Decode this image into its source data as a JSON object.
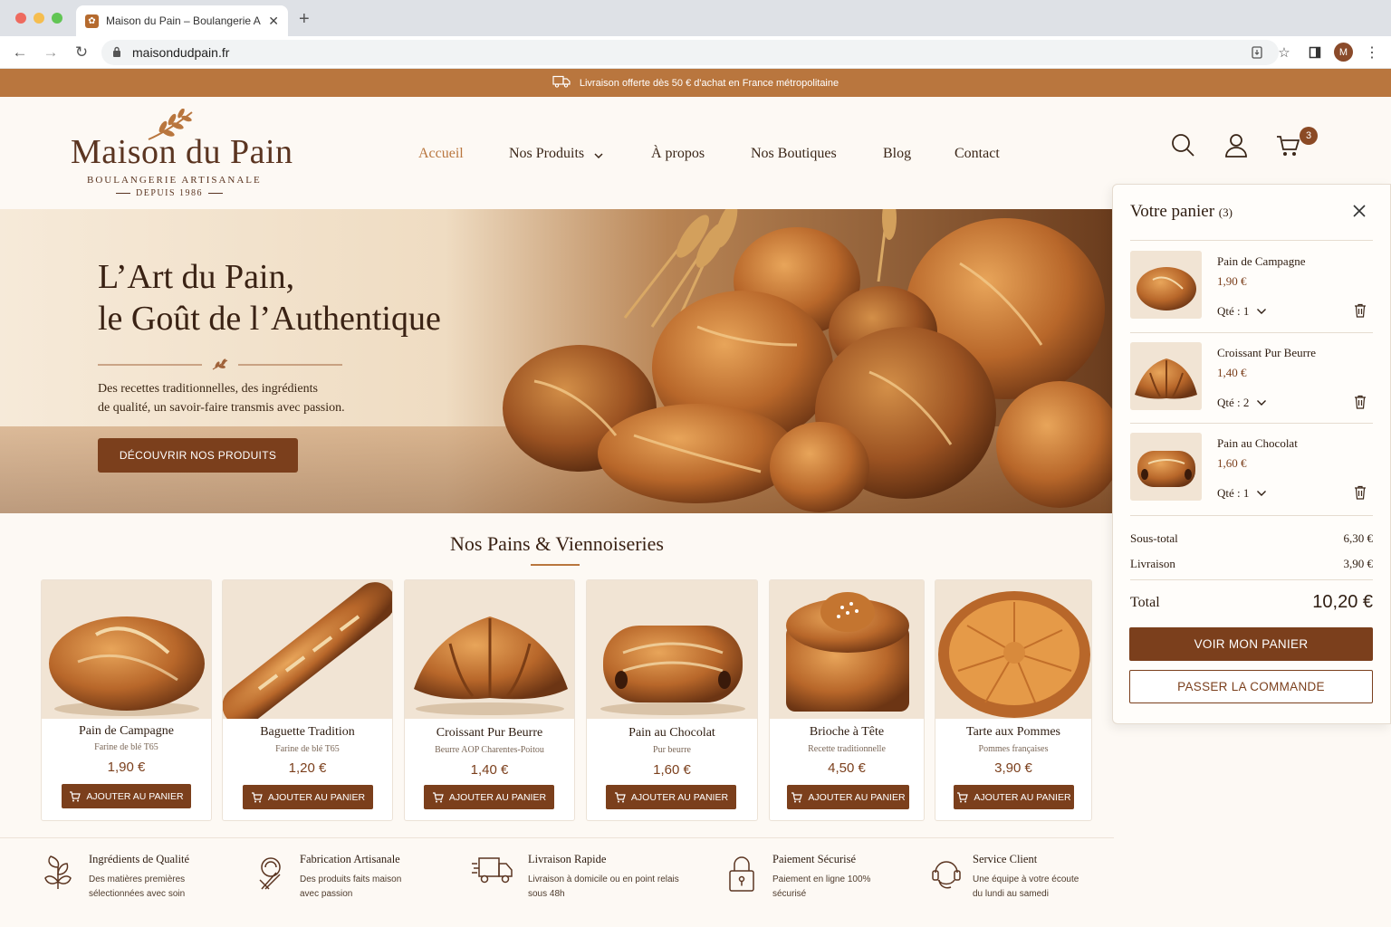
{
  "browser": {
    "tab_title": "Maison du Pain – Boulangerie Artis",
    "url": "maisondudpain.fr",
    "profile_initial": "M"
  },
  "promo": {
    "text": "Livraison offerte dès 50 € d'achat en France métropolitaine"
  },
  "brand": {
    "name": "Maison du Pain",
    "tagline": "BOULANGERIE ARTISANALE",
    "since": "DEPUIS 1986"
  },
  "nav": {
    "items": [
      {
        "label": "Accueil",
        "active": true
      },
      {
        "label": "Nos Produits",
        "has_dropdown": true
      },
      {
        "label": "À propos"
      },
      {
        "label": "Nos Boutiques"
      },
      {
        "label": "Blog"
      },
      {
        "label": "Contact"
      }
    ],
    "cart_count": "3"
  },
  "hero": {
    "title_line1": "L’Art du Pain,",
    "title_line2": "le Goût de l’Authentique",
    "text_line1": "Des recettes traditionnelles, des ingrédients",
    "text_line2": "de qualité, un savoir-faire transmis avec passion.",
    "cta": "DÉCOUVRIR NOS PRODUITS"
  },
  "products": {
    "title": "Nos Pains & Viennoiseries",
    "add_label": "AJOUTER AU PANIER",
    "items": [
      {
        "name": "Pain de Campagne",
        "sub": "Farine de blé T65",
        "price": "1,90 €"
      },
      {
        "name": "Baguette Tradition",
        "sub": "Farine de blé T65",
        "price": "1,20 €"
      },
      {
        "name": "Croissant Pur Beurre",
        "sub": "Beurre AOP Charentes-Poitou",
        "price": "1,40 €"
      },
      {
        "name": "Pain au Chocolat",
        "sub": "Pur beurre",
        "price": "1,60 €"
      },
      {
        "name": "Brioche à Tête",
        "sub": "Recette traditionnelle",
        "price": "4,50 €"
      },
      {
        "name": "Tarte aux Pommes",
        "sub": "Pommes françaises",
        "price": "3,90 €"
      }
    ]
  },
  "features": [
    {
      "title": "Ingrédients de Qualité",
      "line1": "Des matières premières",
      "line2": "sélectionnées avec soin",
      "icon": "leaves-icon"
    },
    {
      "title": "Fabrication Artisanale",
      "line1": "Des produits faits maison",
      "line2": "avec passion",
      "icon": "chef-whisk-icon"
    },
    {
      "title": "Livraison Rapide",
      "line1": "Livraison à domicile ou en point relais",
      "line2": "sous 48h",
      "icon": "truck-icon"
    },
    {
      "title": "Paiement Sécurisé",
      "line1": "Paiement en ligne 100%",
      "line2": "sécurisé",
      "icon": "padlock-icon"
    },
    {
      "title": "Service Client",
      "line1": "Une équipe à votre écoute",
      "line2": "du lundi au samedi",
      "icon": "headset-icon"
    }
  ],
  "cart": {
    "title": "Votre panier",
    "count": "(3)",
    "items": [
      {
        "name": "Pain de Campagne",
        "price": "1,90 €",
        "qty": "Qté : 1"
      },
      {
        "name": "Croissant Pur Beurre",
        "price": "1,40 €",
        "qty": "Qté : 2"
      },
      {
        "name": "Pain au Chocolat",
        "price": "1,60 €",
        "qty": "Qté : 1"
      }
    ],
    "subtotal_label": "Sous-total",
    "subtotal": "6,30 €",
    "shipping_label": "Livraison",
    "shipping": "3,90 €",
    "total_label": "Total",
    "total": "10,20 €",
    "view_cart": "VOIR MON PANIER",
    "checkout": "PASSER LA COMMANDE"
  },
  "colors": {
    "accent": "#7b3f1c",
    "promo_bar": "#b9763e",
    "background": "#fdf9f4"
  }
}
